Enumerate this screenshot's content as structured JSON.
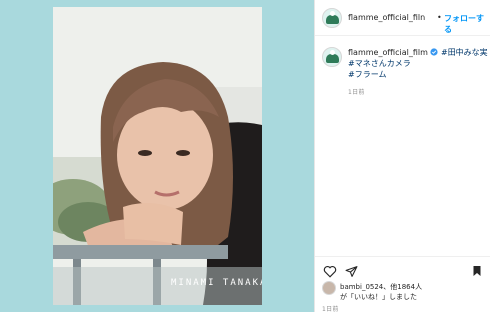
{
  "post": {
    "media": {
      "image_caption_text": "MINAMI TANAKA"
    },
    "header": {
      "username": "flamme_official_filn",
      "separator": "•",
      "follow_label": "フォローする"
    },
    "caption": {
      "username": "flamme_official_film",
      "tag_1": "#田中みな実",
      "tag_2": "#マネさんカメラ",
      "tag_3": "#フラーム",
      "timestamp": "1日前"
    },
    "actions": {
      "heart_icon": "heart-outline",
      "share_icon": "paper-plane",
      "more_icon": "dots-menu",
      "likes_line_1": "bambi_0524、他1864人",
      "likes_line_2": "が「いいね！」しました",
      "timestamp": "1日前"
    }
  },
  "colors": {
    "background": "#a9d9dd",
    "accent": "#0095f6",
    "hashtag": "#00376b"
  }
}
